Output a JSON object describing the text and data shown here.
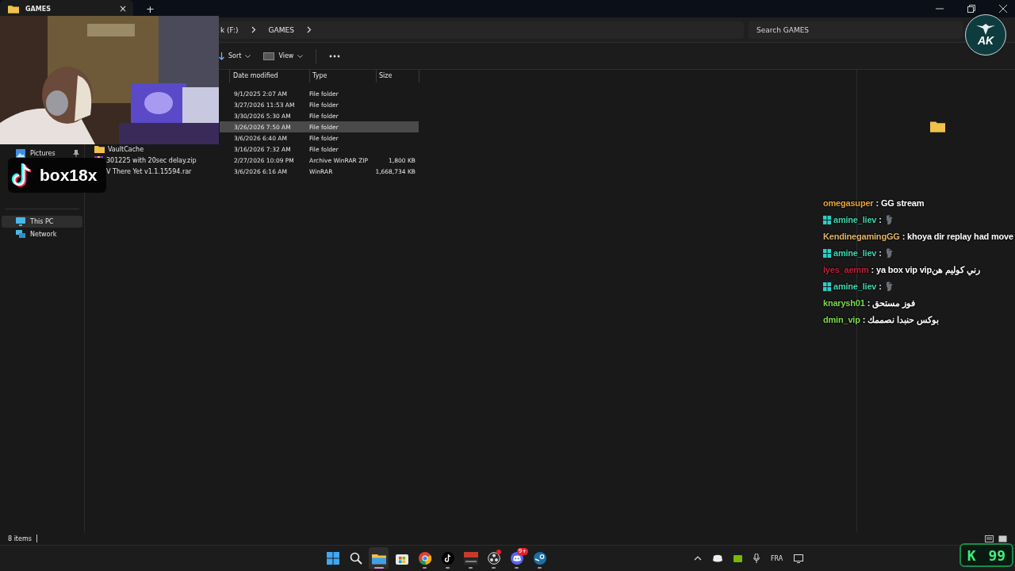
{
  "tab": {
    "title": "GAMES",
    "close": "×"
  },
  "new_tab": "+",
  "breadcrumb": [
    "k (F:)",
    "GAMES"
  ],
  "search": {
    "placeholder": "Search GAMES"
  },
  "toolbar": [
    {
      "label": "Sort",
      "kind": "sort"
    },
    {
      "label": "View",
      "kind": "view"
    }
  ],
  "sidebar": [
    {
      "label": "Pictures",
      "kind": "pictures",
      "pinned": true,
      "selected": false
    },
    {
      "label": "This PC",
      "kind": "pc",
      "pinned": false,
      "selected": true
    },
    {
      "label": "Network",
      "kind": "network",
      "pinned": false,
      "selected": false
    }
  ],
  "columns": [
    "Date modified",
    "Type",
    "Size"
  ],
  "rows": [
    {
      "date": "9/1/2025 2:07 AM",
      "type": "File folder",
      "selected": false
    },
    {
      "date": "3/27/2026 11:53 AM",
      "type": "File folder",
      "selected": false
    },
    {
      "date": "3/30/2026 5:30 AM",
      "type": "File folder",
      "selected": false
    },
    {
      "date": "3/26/2026 7:50 AM",
      "type": "File folder",
      "selected": true
    },
    {
      "date": "3/6/2026 6:40 AM",
      "type": "File folder",
      "selected": false
    },
    {
      "name": "VaultCache",
      "date": "3/16/2026 7:32 AM",
      "type": "File folder",
      "kind": "folder",
      "selected": false
    },
    {
      "name": "301225 with 20sec delay.zip",
      "date": "2/27/2026 10:09 PM",
      "type": "Archive WinRAR ZIP",
      "size": "1,800 KB",
      "kind": "archive",
      "selected": false
    },
    {
      "name": "V There Yet v1.1.15594.rar",
      "date": "3/6/2026 6:16 AM",
      "type": "WinRAR",
      "size": "1,668,734 KB",
      "selected": false
    }
  ],
  "status": "8 items",
  "webcam": {
    "kind": "picture"
  },
  "tiktok": {
    "handle": "box18x"
  },
  "chat": [
    {
      "user": "omegasuper",
      "color": "#e8a33a",
      "badge": false,
      "separator": ":",
      "kind": "text",
      "text": "GG stream"
    },
    {
      "user": "amine_liev",
      "color": "#3fd6b0",
      "badge": true,
      "separator": ":",
      "kind": "emote"
    },
    {
      "user": "KendinegamingGG",
      "color": "#e0b468",
      "badge": false,
      "separator": ":",
      "kind": "text",
      "text": "khoya dir replay had move"
    },
    {
      "user": "amine_liev",
      "color": "#3fd6b0",
      "badge": true,
      "separator": ":",
      "kind": "emote"
    },
    {
      "user": "lyes_aemm",
      "color": "#c0203a",
      "badge": false,
      "separator": ":",
      "kind": "text",
      "text": "ya box vip vipرني كوليم هن"
    },
    {
      "user": "amine_liev",
      "color": "#3fd6b0",
      "badge": true,
      "separator": ":",
      "kind": "emote"
    },
    {
      "user": "knarysh01",
      "color": "#7ed84a",
      "badge": false,
      "separator": ":",
      "kind": "text",
      "text": "فوز مستحق"
    },
    {
      "user": "dmin_vip",
      "color": "#7ed84a",
      "badge": false,
      "separator": ":",
      "kind": "text",
      "text": "بوكس حنبدا نصممك"
    }
  ],
  "logo": {
    "text": "AK"
  },
  "taskbar": [
    {
      "kind": "start",
      "active": false,
      "running": false,
      "dot": false
    },
    {
      "kind": "search",
      "active": false,
      "running": false,
      "dot": false
    },
    {
      "kind": "explorer",
      "active": true,
      "running": true,
      "dot": false
    },
    {
      "kind": "store",
      "active": false,
      "running": false,
      "dot": false
    },
    {
      "kind": "chrome",
      "active": false,
      "running": true,
      "dot": false
    },
    {
      "kind": "tiktok",
      "active": false,
      "running": true,
      "dot": false
    },
    {
      "kind": "voicemeeter",
      "active": false,
      "running": true,
      "dot": false
    },
    {
      "kind": "obs",
      "active": false,
      "running": true,
      "dot": true
    },
    {
      "kind": "discord",
      "active": false,
      "running": true,
      "dot": false,
      "badge": "9+"
    },
    {
      "kind": "steam",
      "active": false,
      "running": true,
      "dot": false
    }
  ],
  "tray": {
    "language": "FRA"
  },
  "counter": {
    "letter": "K",
    "value": "99"
  }
}
